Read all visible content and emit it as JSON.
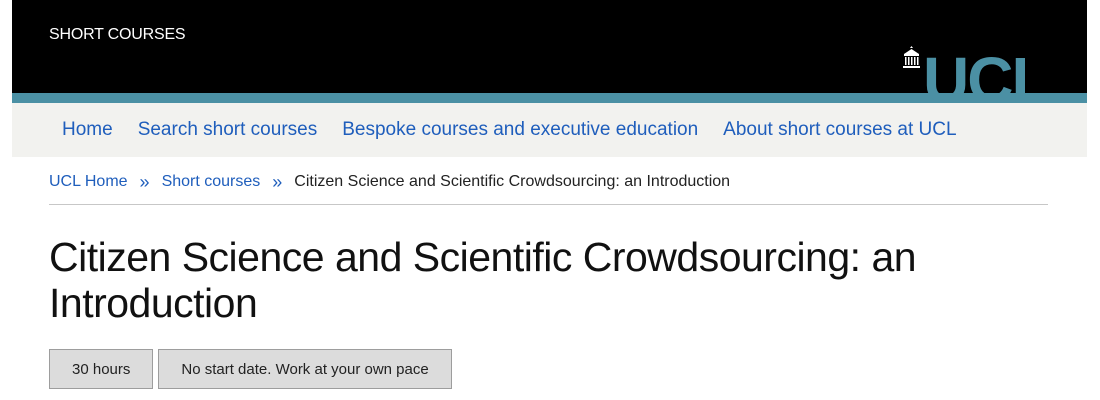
{
  "header": {
    "site_title": "SHORT COURSES",
    "logo_text": "UCL",
    "logo_icon": "ucl-portico-icon",
    "colors": {
      "header_bg": "#000000",
      "accent_teal": "#4b90a4",
      "link_blue": "#1f5ebc",
      "nav_bg": "#f2f2ef",
      "tag_bg": "#dcdcdc"
    }
  },
  "nav": {
    "items": [
      {
        "label": "Home"
      },
      {
        "label": "Search short courses"
      },
      {
        "label": "Bespoke courses and executive education"
      },
      {
        "label": "About short courses at UCL"
      }
    ]
  },
  "breadcrumb": {
    "items": [
      {
        "label": "UCL Home"
      },
      {
        "label": "Short courses"
      }
    ],
    "separator": "»",
    "current": "Citizen Science and Scientific Crowdsourcing: an Introduction"
  },
  "page": {
    "title": "Citizen Science and Scientific Crowdsourcing: an Introduction",
    "tags": [
      {
        "label": "30 hours"
      },
      {
        "label": "No start date. Work at your own pace"
      }
    ]
  }
}
